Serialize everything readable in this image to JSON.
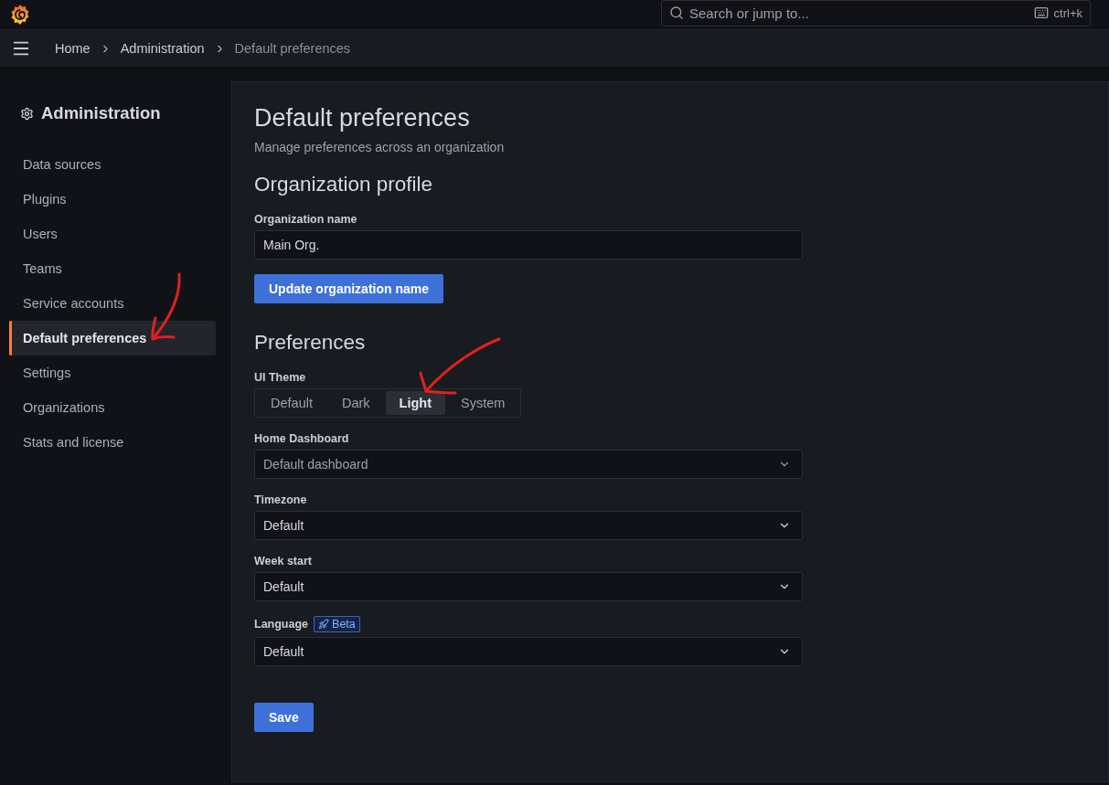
{
  "top_bar": {
    "search": {
      "placeholder": "Search or jump to...",
      "shortcut": "ctrl+k"
    }
  },
  "breadcrumbs": [
    {
      "label": "Home",
      "current": false
    },
    {
      "label": "Administration",
      "current": false
    },
    {
      "label": "Default preferences",
      "current": true
    }
  ],
  "sidebar": {
    "title": "Administration",
    "items": [
      {
        "label": "Data sources",
        "selected": false
      },
      {
        "label": "Plugins",
        "selected": false
      },
      {
        "label": "Users",
        "selected": false
      },
      {
        "label": "Teams",
        "selected": false
      },
      {
        "label": "Service accounts",
        "selected": false
      },
      {
        "label": "Default preferences",
        "selected": true
      },
      {
        "label": "Settings",
        "selected": false
      },
      {
        "label": "Organizations",
        "selected": false
      },
      {
        "label": "Stats and license",
        "selected": false
      }
    ]
  },
  "page": {
    "title": "Default preferences",
    "subtitle": "Manage preferences across an organization"
  },
  "organization_profile": {
    "heading": "Organization profile",
    "field_label": "Organization name",
    "value": "Main Org.",
    "button": "Update organization name"
  },
  "preferences": {
    "heading": "Preferences",
    "ui_theme": {
      "label": "UI Theme",
      "options": [
        {
          "label": "Default",
          "selected": false
        },
        {
          "label": "Dark",
          "selected": false
        },
        {
          "label": "Light",
          "selected": true
        },
        {
          "label": "System",
          "selected": false
        }
      ]
    },
    "selects": [
      {
        "label": "Home Dashboard",
        "placeholder": "Default dashboard"
      },
      {
        "label": "Timezone",
        "value": "Default"
      },
      {
        "label": "Week start",
        "value": "Default"
      },
      {
        "label": "Language",
        "badge": "Beta",
        "value": "Default"
      }
    ],
    "save_button": "Save"
  }
}
